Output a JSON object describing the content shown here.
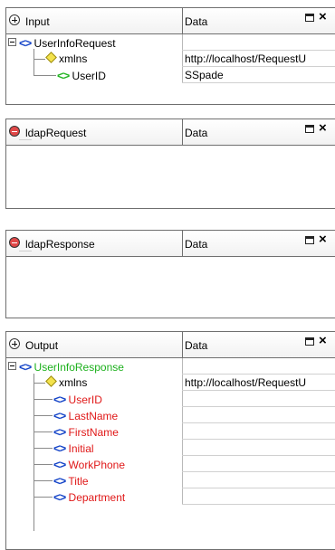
{
  "input_panel": {
    "title": "Input",
    "column_label": "Data",
    "close_label": "×",
    "root": {
      "tag": "<>",
      "label": "UserInfoRequest"
    },
    "rows": [
      {
        "type": "attribute",
        "label": "xmlns",
        "value": "http://localhost/RequestU"
      },
      {
        "type": "element",
        "tag": "<>",
        "label": "UserID",
        "value": "SSpade"
      }
    ]
  },
  "ldap_request_panel": {
    "title": "ldapRequest",
    "column_label": "Data",
    "close_label": "×"
  },
  "ldap_response_panel": {
    "title": "ldapResponse",
    "column_label": "Data",
    "close_label": "×"
  },
  "output_panel": {
    "title": "Output",
    "column_label": "Data",
    "close_label": "×",
    "root": {
      "tag": "<>",
      "label": "UserInfoResponse"
    },
    "rows": [
      {
        "type": "attribute",
        "label": "xmlns",
        "value": "http://localhost/RequestU"
      },
      {
        "type": "element",
        "tag": "<>",
        "label": "UserID",
        "value": ""
      },
      {
        "type": "element",
        "tag": "<>",
        "label": "LastName",
        "value": ""
      },
      {
        "type": "element",
        "tag": "<>",
        "label": "FirstName",
        "value": ""
      },
      {
        "type": "element",
        "tag": "<>",
        "label": "Initial",
        "value": ""
      },
      {
        "type": "element",
        "tag": "<>",
        "label": "WorkPhone",
        "value": ""
      },
      {
        "type": "element",
        "tag": "<>",
        "label": "Title",
        "value": ""
      },
      {
        "type": "element",
        "tag": "<>",
        "label": "Department",
        "value": ""
      }
    ]
  },
  "colors": {
    "element_tag_blue": "#1444c8",
    "element_tag_green": "#22b422",
    "unmapped_red": "#e01818",
    "root_green": "#1cb01c",
    "panel_border": "#6f6f6f"
  },
  "icons": {
    "expand": "plus-circle-icon",
    "collapse": "minus-circle-icon",
    "maximize": "maximize-icon",
    "close": "close-icon",
    "attribute": "attribute-diamond-icon",
    "element": "element-tag-icon",
    "tree_collapse": "tree-collapse-icon"
  }
}
